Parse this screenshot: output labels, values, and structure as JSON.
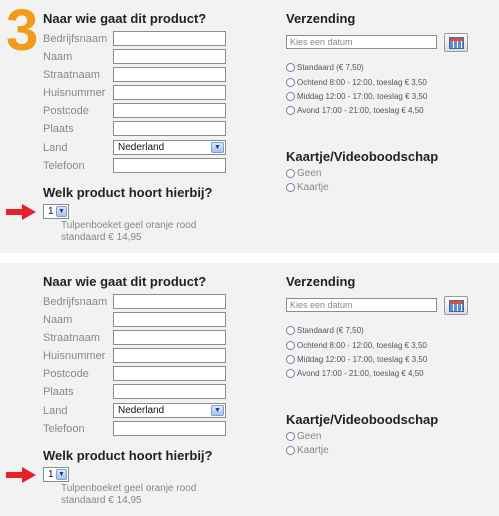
{
  "step_number": "3",
  "sections": [
    {
      "recipient_title": "Naar wie gaat dit product?",
      "fields": [
        {
          "label": "Bedrijfsnaam"
        },
        {
          "label": "Naam"
        },
        {
          "label": "Straatnaam"
        },
        {
          "label": "Huisnummer"
        },
        {
          "label": "Postcode"
        },
        {
          "label": "Plaats"
        },
        {
          "label": "Land",
          "value": "Nederland"
        },
        {
          "label": "Telefoon"
        }
      ],
      "product_title": "Welk product hoort hierbij?",
      "quantity": "1",
      "product_line1": "Tulpenboeket geel oranje rood",
      "product_line2": "standaard € 14,95",
      "shipping_title": "Verzending",
      "date_placeholder": "Kies een datum",
      "shipping_options": [
        "Standaard (€ 7,50)",
        "Ochtend 8:00 - 12:00, toeslag € 3,50",
        "Middag 12:00 - 17:00, toeslag € 3,50",
        "Avond 17:00 - 21:00, toeslag € 4,50"
      ],
      "card_title": "Kaartje/Videoboodschap",
      "card_options": [
        "Geen",
        "Kaartje"
      ]
    },
    {
      "recipient_title": "Naar wie gaat dit product?",
      "fields": [
        {
          "label": "Bedrijfsnaam"
        },
        {
          "label": "Naam"
        },
        {
          "label": "Straatnaam"
        },
        {
          "label": "Huisnummer"
        },
        {
          "label": "Postcode"
        },
        {
          "label": "Plaats"
        },
        {
          "label": "Land",
          "value": "Nederland"
        },
        {
          "label": "Telefoon"
        }
      ],
      "product_title": "Welk product hoort hierbij?",
      "quantity": "1",
      "product_line1": "Tulpenboeket geel oranje rood",
      "product_line2": "standaard € 14,95",
      "shipping_title": "Verzending",
      "date_placeholder": "Kies een datum",
      "shipping_options": [
        "Standaard (€ 7,50)",
        "Ochtend 8:00 - 12:00, toeslag € 3,50",
        "Middag 12:00 - 17:00, toeslag € 3,50",
        "Avond 17:00 - 21:00, toeslag € 4,50"
      ],
      "card_title": "Kaartje/Videoboodschap",
      "card_options": [
        "Geen",
        "Kaartje"
      ]
    }
  ],
  "colors": {
    "step_number": "#f39a1b",
    "arrow": "#e8202a",
    "panel_background": "#f2f2f2"
  }
}
